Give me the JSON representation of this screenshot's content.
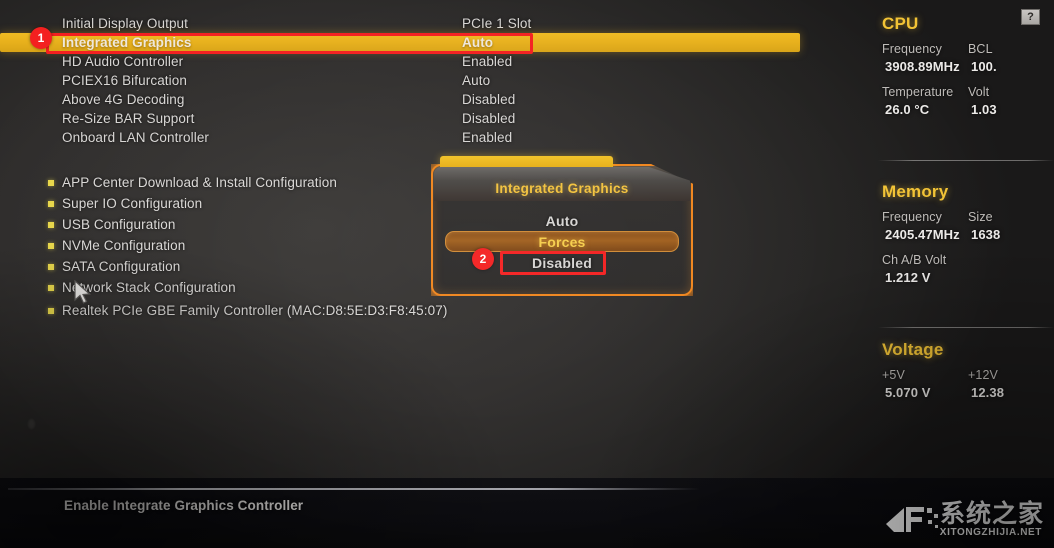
{
  "settings": {
    "rows": [
      {
        "label": "Initial Display Output",
        "value": "PCIe 1 Slot",
        "selected": false
      },
      {
        "label": "Integrated Graphics",
        "value": "Auto",
        "selected": true
      },
      {
        "label": "HD Audio Controller",
        "value": "Enabled",
        "selected": false
      },
      {
        "label": "PCIEX16 Bifurcation",
        "value": "Auto",
        "selected": false
      },
      {
        "label": "Above 4G Decoding",
        "value": "Disabled",
        "selected": false
      },
      {
        "label": "Re-Size BAR Support",
        "value": "Disabled",
        "selected": false
      },
      {
        "label": "Onboard LAN Controller",
        "value": "Enabled",
        "selected": false
      }
    ]
  },
  "submenus": {
    "items": [
      {
        "label": "APP Center Download & Install Configuration"
      },
      {
        "label": "Super IO Configuration"
      },
      {
        "label": "USB Configuration"
      },
      {
        "label": "NVMe Configuration"
      },
      {
        "label": "SATA Configuration"
      },
      {
        "label": "Network Stack Configuration"
      }
    ],
    "device": "Realtek PCIe GBE Family Controller (MAC:D8:5E:D3:F8:45:07)"
  },
  "popup": {
    "title": "Integrated Graphics",
    "options": [
      {
        "label": "Auto",
        "active": false
      },
      {
        "label": "Forces",
        "active": true
      },
      {
        "label": "Disabled",
        "active": false
      }
    ]
  },
  "sidebar": {
    "cpu": {
      "header": "CPU",
      "freq_name": "Frequency",
      "freq_value": "3908.89MHz",
      "bclk_name": "BCL",
      "bclk_value": "100.",
      "temp_name": "Temperature",
      "temp_value": "26.0 °C",
      "volt_name": "Volt",
      "volt_value": "1.03"
    },
    "memory": {
      "header": "Memory",
      "freq_name": "Frequency",
      "freq_value": "2405.47MHz",
      "size_name": "Size",
      "size_value": "1638",
      "chvolt_name": "Ch A/B Volt",
      "chvolt_value": "1.212 V"
    },
    "voltage": {
      "header": "Voltage",
      "v5_name": "+5V",
      "v5_value": "5.070 V",
      "v12_name": "+12V",
      "v12_value": "12.38"
    }
  },
  "help_button": {
    "glyph": "?"
  },
  "footer": {
    "help_text": "Enable Integrate Graphics Controller"
  },
  "watermark": {
    "cn": "系统之家",
    "en": "XITONGZHIJIA.NET"
  },
  "annotations": {
    "badges": [
      {
        "number": "1"
      },
      {
        "number": "2"
      }
    ]
  },
  "colors": {
    "highlight_yellow": "#e7b01c",
    "accent_orange": "#f0851c",
    "header_gold": "#f2c335",
    "annotation_red": "#f42020"
  }
}
